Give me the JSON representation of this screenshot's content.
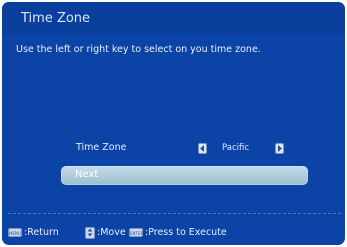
{
  "header": {
    "title": "Time Zone"
  },
  "instruction": "Use the left or right key to select on you time zone.",
  "time_zone": {
    "label": "Time Zone",
    "value": "Pacific"
  },
  "next_button": {
    "label": "Next"
  },
  "footer": {
    "menu_key_text": "MENU",
    "return_label": ":Return",
    "move_label": ":Move",
    "enter_key_text": "ENTER",
    "execute_label": ":Press to Execute"
  },
  "icons": [
    "menu-key-icon",
    "updown-arrow-icon",
    "enter-key-icon",
    "left-arrow-icon",
    "right-arrow-icon"
  ],
  "colors": {
    "background": "#0b44a6",
    "text": "#e6efff",
    "button": "#b3cfe0"
  }
}
